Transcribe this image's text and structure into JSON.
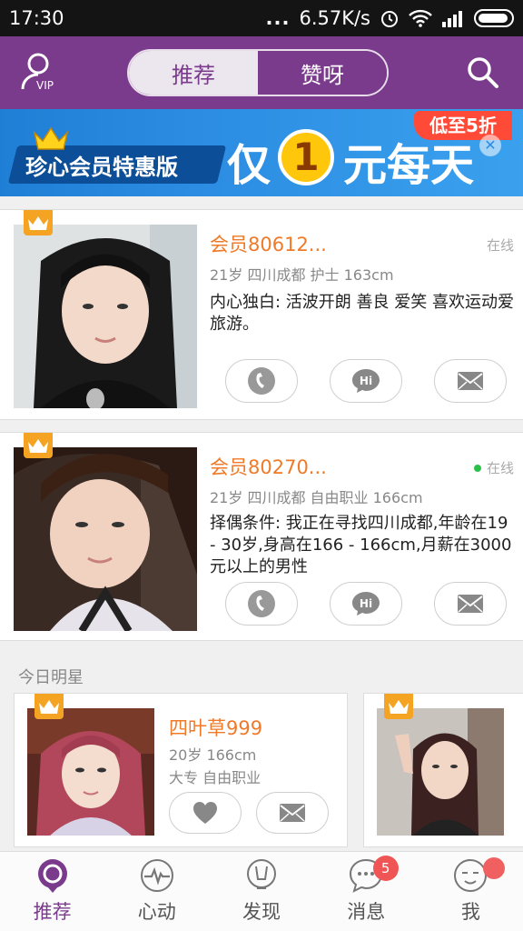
{
  "status_bar": {
    "time": "17:30",
    "speed": "6.57K/s"
  },
  "header": {
    "vip_label": "VIP",
    "tabs": [
      {
        "label": "推荐",
        "active": true
      },
      {
        "label": "赞呀",
        "active": false
      }
    ],
    "accent_color": "#7a3b8c"
  },
  "banner": {
    "ribbon_text": "珍心会员特惠版",
    "text_before": "仅",
    "number": "1",
    "text_after": "元每天",
    "discount": "低至5折"
  },
  "cards": [
    {
      "name": "会员80612...",
      "status": "在线",
      "show_online_dot": false,
      "info": "21岁  四川成都 护士 163cm",
      "desc": "内心独白: 活波开朗 善良 爱笑 喜欢运动爱旅游。"
    },
    {
      "name": "会员80270...",
      "status": "在线",
      "show_online_dot": true,
      "info": "21岁  四川成都 自由职业 166cm",
      "desc": "择偶条件: 我正在寻找四川成都,年龄在19 - 30岁,身高在166 - 166cm,月薪在3000元以上的男性"
    }
  ],
  "today_stars": {
    "title": "今日明星",
    "items": [
      {
        "name": "四叶草999",
        "info1": "20岁   166cm",
        "info2": "大专   自由职业"
      }
    ]
  },
  "bottom_nav": [
    {
      "label": "推荐",
      "icon": "recommend-icon",
      "active": true
    },
    {
      "label": "心动",
      "icon": "heartbeat-icon",
      "active": false
    },
    {
      "label": "发现",
      "icon": "discover-icon",
      "active": false
    },
    {
      "label": "消息",
      "icon": "message-icon",
      "active": false,
      "badge": "5"
    },
    {
      "label": "我",
      "icon": "profile-icon",
      "active": false,
      "dot": true
    }
  ]
}
